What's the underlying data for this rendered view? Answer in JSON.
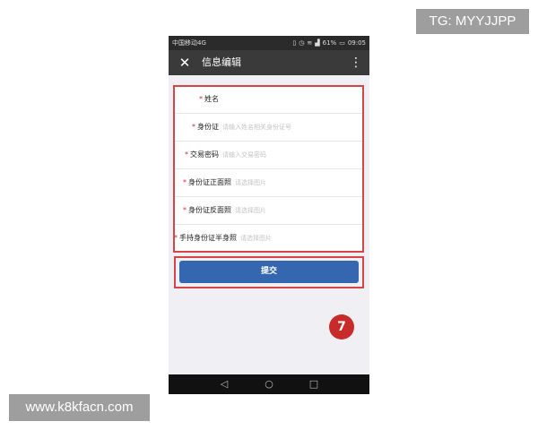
{
  "watermarks": {
    "tg": "TG: MYYJJPP",
    "site": "www.k8kfacn.com"
  },
  "statusbar": {
    "carrier": "中国移动4G",
    "battery": "61%",
    "time": "09:05",
    "icons": [
      "vibrate-icon",
      "alarm-icon",
      "wifi-icon",
      "signal-icon",
      "battery-icon"
    ]
  },
  "appbar": {
    "close_icon": "✕",
    "title": "信息编辑",
    "more_icon": "⋮"
  },
  "form": {
    "rows": [
      {
        "required": "*",
        "label": "姓名",
        "placeholder": ""
      },
      {
        "required": "*",
        "label": "身份证",
        "placeholder": "请输入姓名相关身份证号"
      },
      {
        "required": "*",
        "label": "交易密码",
        "placeholder": "请输入交易密码"
      },
      {
        "required": "*",
        "label": "身份证正面照",
        "placeholder": "请选择图片"
      },
      {
        "required": "*",
        "label": "身份证反面照",
        "placeholder": "请选择图片"
      },
      {
        "required": "*",
        "label": "手持身份证半身照",
        "placeholder": "请选择图片"
      }
    ]
  },
  "submit": {
    "label": "提交"
  },
  "step_badge": "7",
  "navbar": {
    "back_icon": "◁",
    "home_icon": "○",
    "recent_icon": "□"
  },
  "colors": {
    "highlight": "#d64545",
    "button": "#3467b0",
    "badge": "#c92a2a",
    "appbar": "#3a3a3a"
  }
}
